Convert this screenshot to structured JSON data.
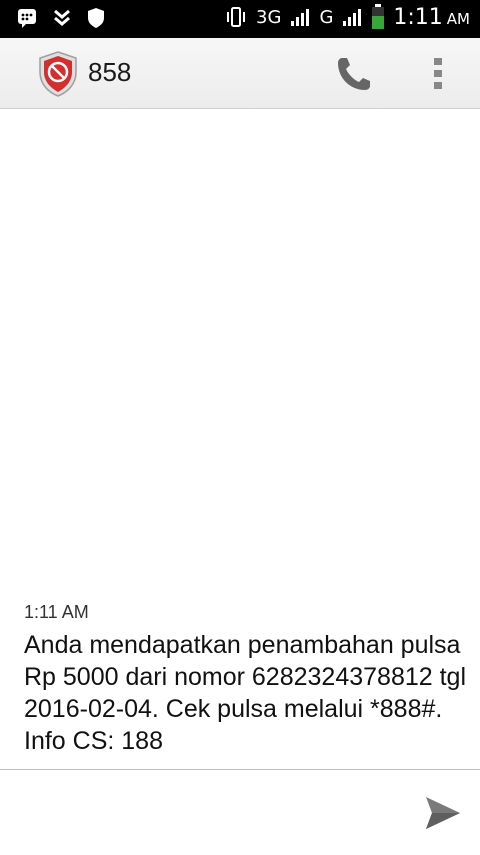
{
  "status_bar": {
    "network_1": "3G",
    "network_2": "G",
    "time": "1:11",
    "ampm": "AM"
  },
  "header": {
    "title": "858"
  },
  "message": {
    "time": "1:11 AM",
    "body": "Anda mendapatkan penambahan pulsa Rp 5000 dari nomor 6282324378812 tgl 2016-02-04. Cek pulsa melalui *888#. Info CS: 188"
  },
  "compose": {
    "placeholder": ""
  },
  "colors": {
    "status_bar_bg": "#000000",
    "app_bar_bg": "#f0f0f0",
    "shield_red": "#d32f2f",
    "icon_gray": "#666666"
  }
}
